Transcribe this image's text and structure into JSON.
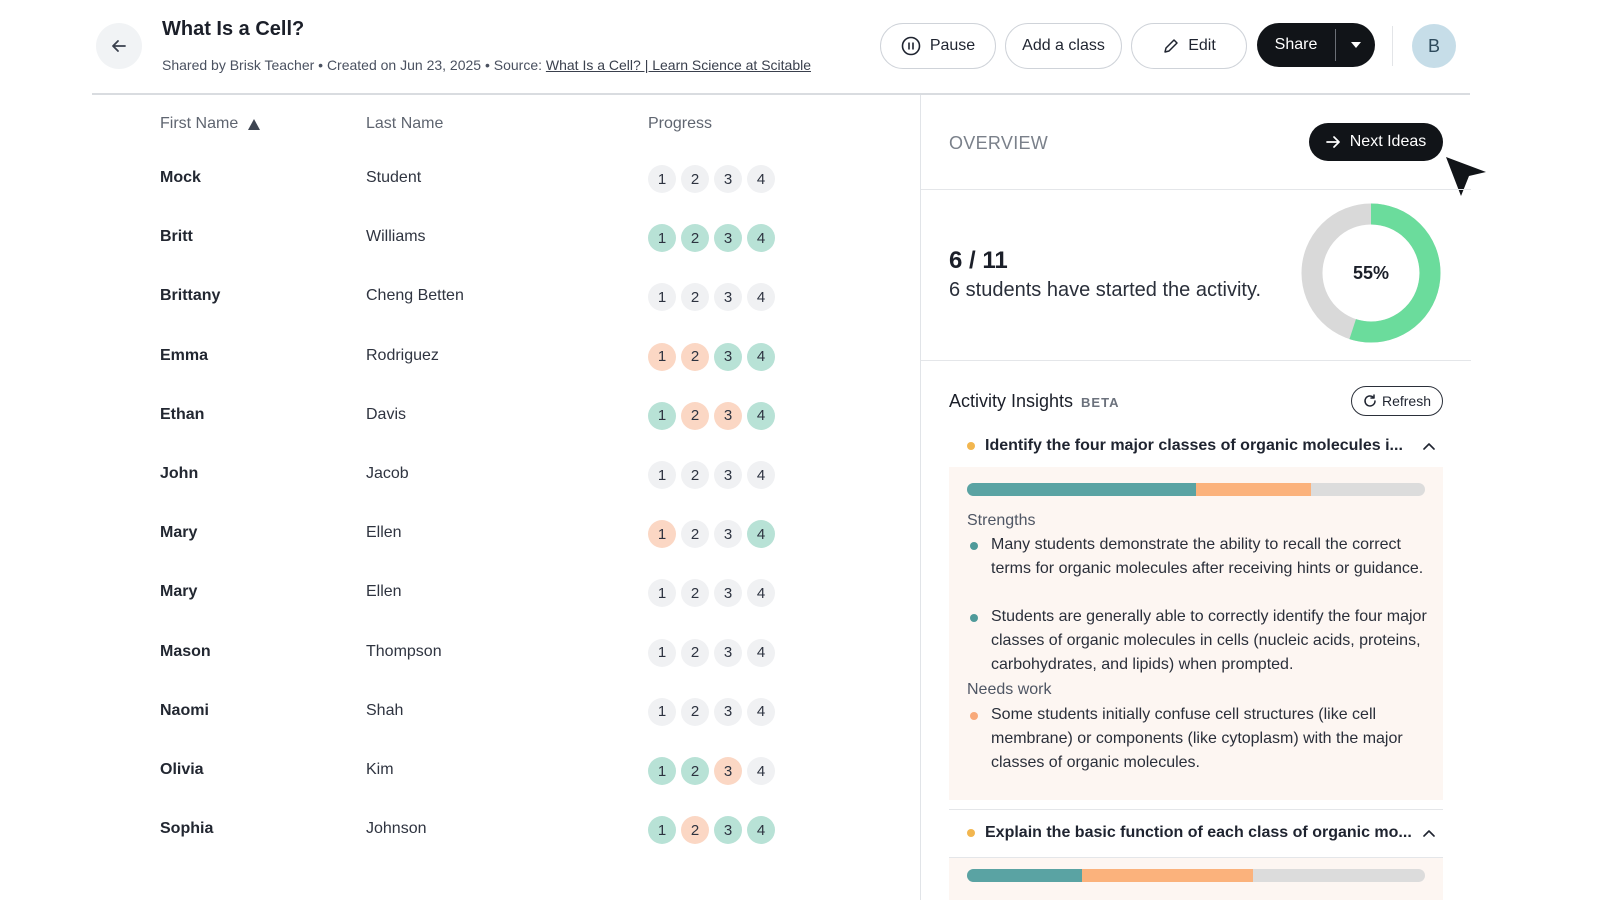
{
  "header": {
    "title": "What Is a Cell?",
    "meta_prefix": "Shared by Brisk Teacher • Created on Jun 23, 2025 • Source: ",
    "source_link": "What Is a Cell? | Learn Science at Scitable",
    "pause_label": "Pause",
    "add_class_label": "Add a class",
    "edit_label": "Edit",
    "share_label": "Share",
    "avatar_initial": "B"
  },
  "table": {
    "headers": {
      "first": "First Name",
      "last": "Last Name",
      "progress": "Progress"
    },
    "rows": [
      {
        "first": "Mock",
        "last": "Student",
        "progress": [
          "n",
          "n",
          "n",
          "n"
        ]
      },
      {
        "first": "Britt",
        "last": "Williams",
        "progress": [
          "g",
          "g",
          "g",
          "g"
        ]
      },
      {
        "first": "Brittany",
        "last": "Cheng Betten",
        "progress": [
          "n",
          "n",
          "n",
          "n"
        ]
      },
      {
        "first": "Emma",
        "last": "Rodriguez",
        "progress": [
          "o",
          "o",
          "g",
          "g"
        ]
      },
      {
        "first": "Ethan",
        "last": "Davis",
        "progress": [
          "g",
          "o",
          "o",
          "g"
        ]
      },
      {
        "first": "John",
        "last": "Jacob",
        "progress": [
          "n",
          "n",
          "n",
          "n"
        ]
      },
      {
        "first": "Mary",
        "last": "Ellen",
        "progress": [
          "o",
          "n",
          "n",
          "g"
        ]
      },
      {
        "first": "Mary",
        "last": "Ellen",
        "progress": [
          "n",
          "n",
          "n",
          "n"
        ]
      },
      {
        "first": "Mason",
        "last": "Thompson",
        "progress": [
          "n",
          "n",
          "n",
          "n"
        ]
      },
      {
        "first": "Naomi",
        "last": "Shah",
        "progress": [
          "n",
          "n",
          "n",
          "n"
        ]
      },
      {
        "first": "Olivia",
        "last": "Kim",
        "progress": [
          "g",
          "g",
          "o",
          "n"
        ]
      },
      {
        "first": "Sophia",
        "last": "Johnson",
        "progress": [
          "g",
          "o",
          "g",
          "g"
        ]
      }
    ],
    "badge_numbers": [
      "1",
      "2",
      "3",
      "4"
    ]
  },
  "overview": {
    "title": "OVERVIEW",
    "next_ideas_label": "Next Ideas",
    "stat_fraction": "6 / 11",
    "stat_text": "6 students have started the activity.",
    "percent_label": "55%",
    "percent_value": 0.55,
    "colors": {
      "done": "#6bdc9c",
      "remaining": "#d9d9d9"
    }
  },
  "insights": {
    "title": "Activity Insights",
    "beta": "BETA",
    "refresh_label": "Refresh",
    "items": [
      {
        "title": "Identify the four major classes of organic molecules i...",
        "bar": {
          "strong": 0.5,
          "needs_work": 0.25
        },
        "strengths_label": "Strengths",
        "strengths": [
          "Many students demonstrate the ability to recall the correct terms for organic molecules after receiving hints or guidance.",
          "Students are generally able to correctly identify the four major classes of organic molecules in cells (nucleic acids, proteins, carbohydrates, and lipids) when prompted."
        ],
        "needs_label": "Needs work",
        "needs": [
          "Some students initially confuse cell structures (like cell membrane) or components (like cytoplasm) with the major classes of organic molecules."
        ]
      },
      {
        "title": "Explain the basic function of each class of organic mo...",
        "bar": {
          "strong": 0.25,
          "needs_work": 0.375
        }
      }
    ]
  }
}
